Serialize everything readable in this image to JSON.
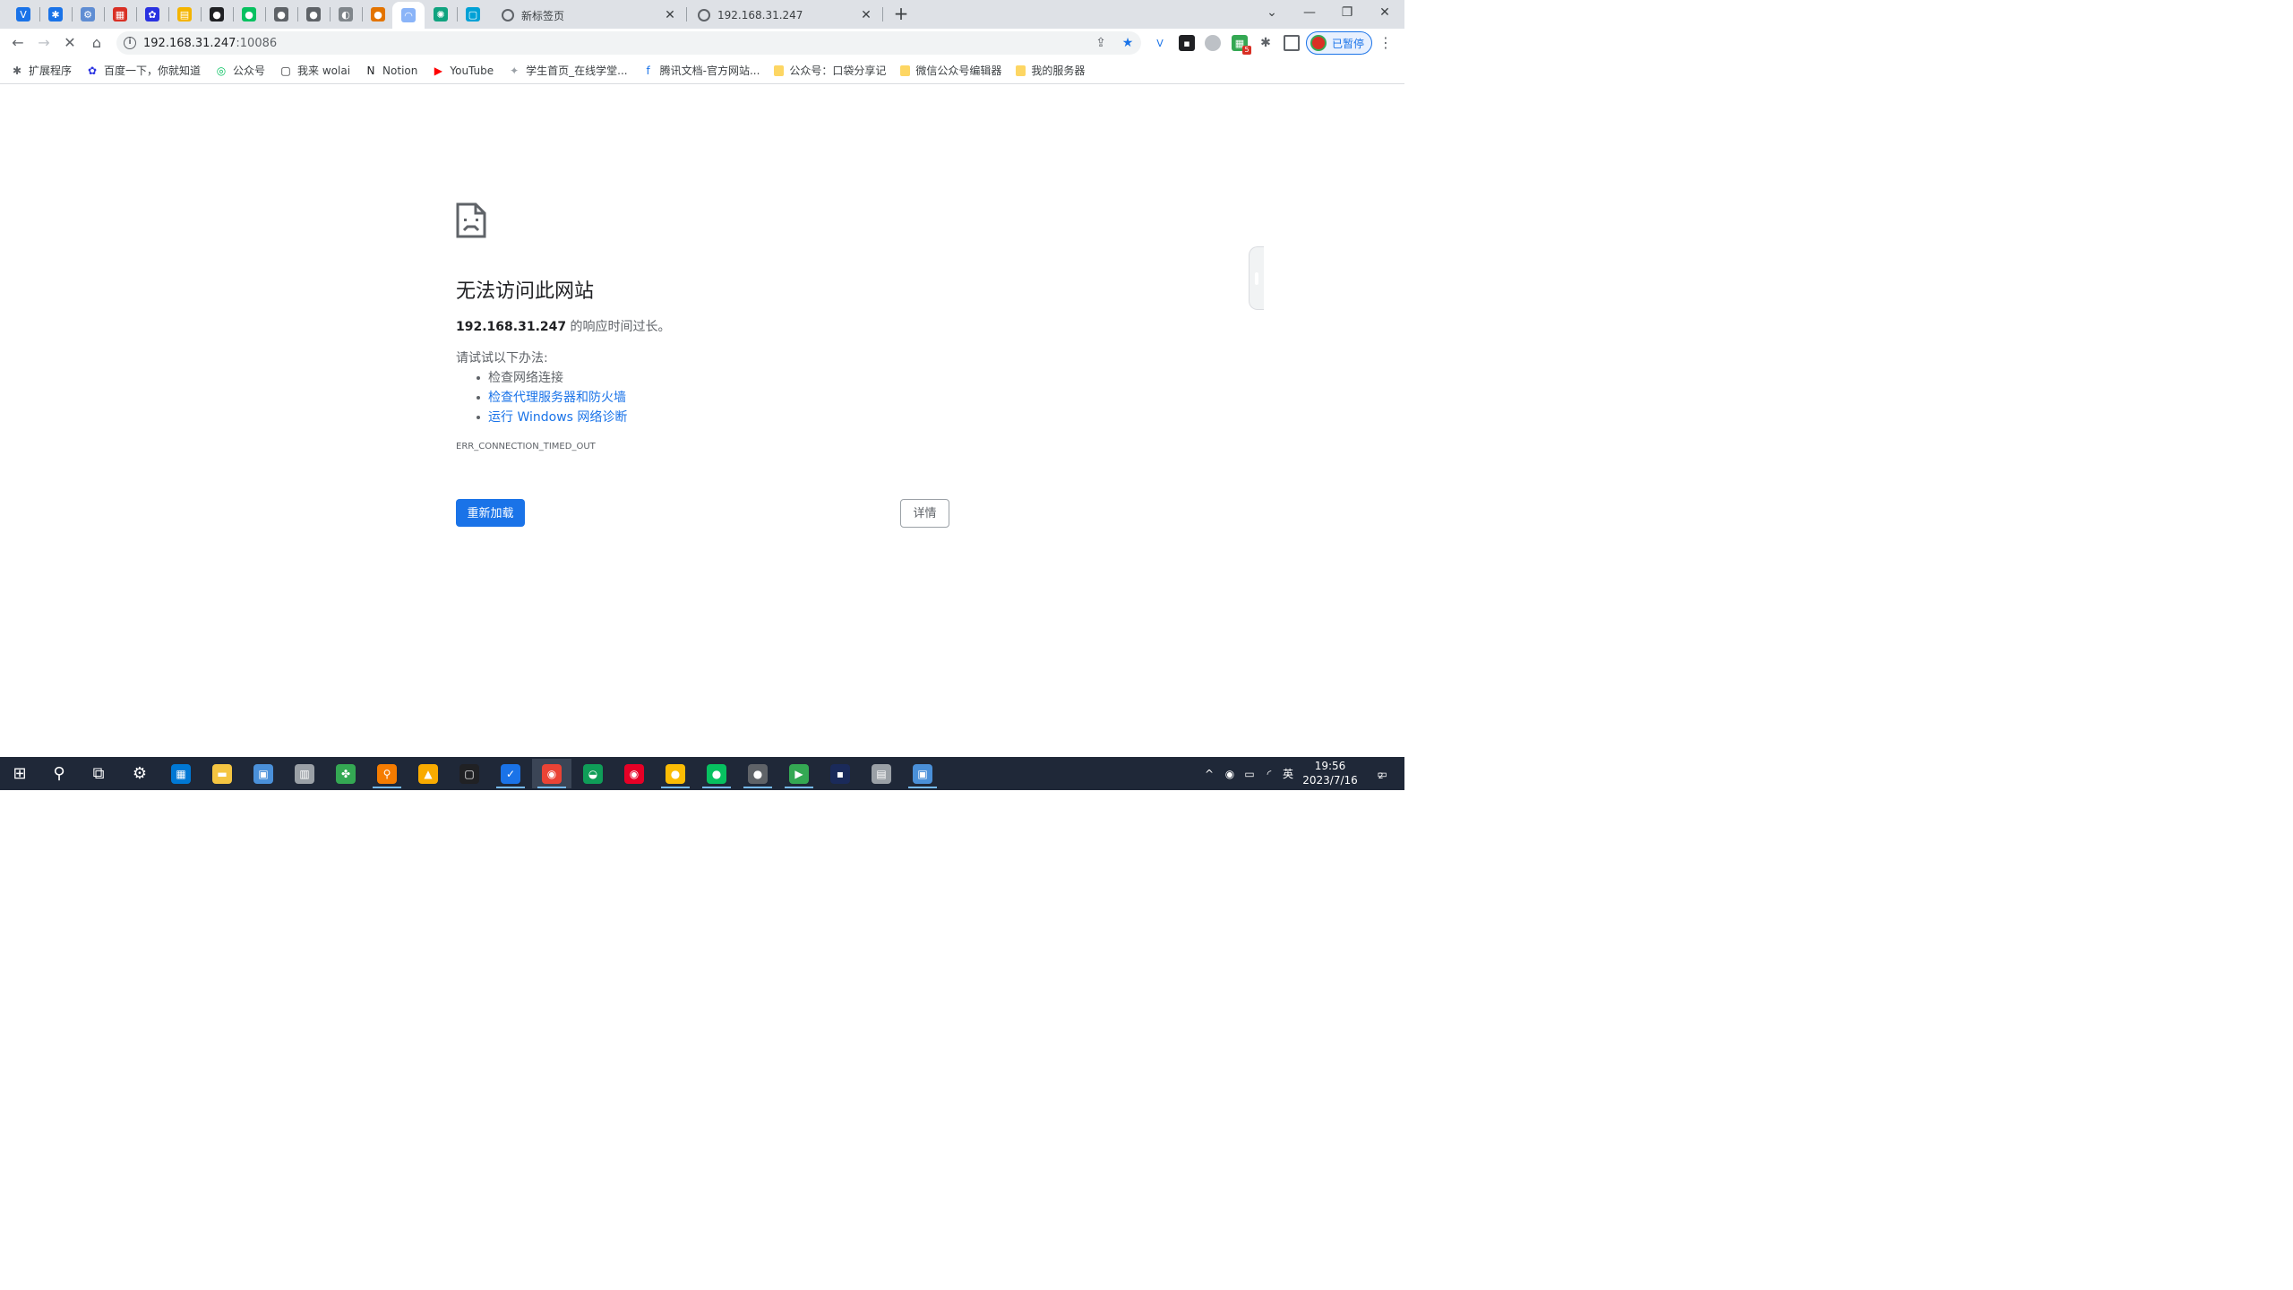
{
  "browser": {
    "pinned_tabs": [
      {
        "name": "pinned-tab-v",
        "glyph": "V",
        "color": "#1a73e8"
      },
      {
        "name": "pinned-tab-puzzle",
        "glyph": "✱",
        "color": "#1a73e8"
      },
      {
        "name": "pinned-tab-gear",
        "glyph": "⚙",
        "color": "#5f8dd3"
      },
      {
        "name": "pinned-tab-grid",
        "glyph": "▦",
        "color": "#d93025"
      },
      {
        "name": "pinned-tab-baidu",
        "glyph": "✿",
        "color": "#2932e1"
      },
      {
        "name": "pinned-tab-chart",
        "glyph": "▤",
        "color": "#f4b400"
      },
      {
        "name": "pinned-tab-qq",
        "glyph": "●",
        "color": "#202124"
      },
      {
        "name": "pinned-tab-wechat",
        "glyph": "●",
        "color": "#07c160"
      },
      {
        "name": "pinned-tab-github-1",
        "glyph": "●",
        "color": "#5f6368"
      },
      {
        "name": "pinned-tab-github-2",
        "glyph": "●",
        "color": "#5f6368"
      },
      {
        "name": "pinned-tab-globe",
        "glyph": "◐",
        "color": "#80868b"
      },
      {
        "name": "pinned-tab-fox",
        "glyph": "●",
        "color": "#e37400"
      },
      {
        "name": "pinned-tab-loading",
        "glyph": "◠",
        "color": "#8ab4f8"
      },
      {
        "name": "pinned-tab-chatgpt",
        "glyph": "✺",
        "color": "#10a37f"
      },
      {
        "name": "pinned-tab-bilibili",
        "glyph": "▢",
        "color": "#00a1d6"
      }
    ],
    "tabs": [
      {
        "title": "新标签页"
      },
      {
        "title": "192.168.31.247"
      }
    ],
    "window_controls": {
      "tabsearch": "⌄",
      "minimize": "—",
      "restore": "❐",
      "close": "✕"
    },
    "nav": {
      "back": "←",
      "forward": "→",
      "reload": "✕",
      "home": "⌂"
    },
    "url_host": "192.168.31.247",
    "url_port": ":10086",
    "profile_label": "已暂停",
    "extension_badge": "5"
  },
  "bookmarks": [
    {
      "label": "扩展程序",
      "glyph": "✱",
      "color": "#5f6368"
    },
    {
      "label": "百度一下，你就知道",
      "glyph": "✿",
      "color": "#2932e1"
    },
    {
      "label": "公众号",
      "glyph": "◎",
      "color": "#07c160"
    },
    {
      "label": "我来 wolai",
      "glyph": "▢",
      "color": "#202124"
    },
    {
      "label": "Notion",
      "glyph": "N",
      "color": "#202124"
    },
    {
      "label": "YouTube",
      "glyph": "▶",
      "color": "#ff0000"
    },
    {
      "label": "学生首页_在线学堂...",
      "glyph": "✦",
      "color": "#9aa0a6"
    },
    {
      "label": "腾讯文档-官方网站...",
      "glyph": "f",
      "color": "#1a73e8"
    },
    {
      "label": "公众号：口袋分享记",
      "glyph": "",
      "color": "#fdd663"
    },
    {
      "label": "微信公众号编辑器",
      "glyph": "",
      "color": "#fdd663"
    },
    {
      "label": "我的服务器",
      "glyph": "",
      "color": "#fdd663"
    }
  ],
  "error_page": {
    "title": "无法访问此网站",
    "host": "192.168.31.247",
    "desc_suffix": " 的响应时间过长。",
    "try_label": "请试试以下办法:",
    "suggestions": [
      {
        "text": "检查网络连接",
        "link": false
      },
      {
        "text": "检查代理服务器和防火墙",
        "link": true
      },
      {
        "text": "运行 Windows 网络诊断",
        "link": true
      }
    ],
    "error_code": "ERR_CONNECTION_TIMED_OUT",
    "reload_label": "重新加载",
    "details_label": "详情"
  },
  "taskbar": {
    "apps": [
      {
        "name": "start-button",
        "glyph": "⊞",
        "color": "#ffffff"
      },
      {
        "name": "search-button",
        "glyph": "⚲",
        "color": "#ffffff"
      },
      {
        "name": "task-view-button",
        "glyph": "⧉",
        "color": "#ffffff"
      },
      {
        "name": "settings-app",
        "glyph": "⚙",
        "color": "#ffffff"
      },
      {
        "name": "store-app",
        "glyph": "▦",
        "color": "#0078d4"
      },
      {
        "name": "explorer-app",
        "glyph": "▬",
        "color": "#f4c542"
      },
      {
        "name": "control-panel-app",
        "glyph": "▣",
        "color": "#4a90d9"
      },
      {
        "name": "bin-app",
        "glyph": "▥",
        "color": "#9aa0a6"
      },
      {
        "name": "clover-app",
        "glyph": "✤",
        "color": "#34a853"
      },
      {
        "name": "everything-app",
        "glyph": "⚲",
        "color": "#f57c00"
      },
      {
        "name": "media-app",
        "glyph": "▲",
        "color": "#f9ab00"
      },
      {
        "name": "terminal-app",
        "glyph": "▢",
        "color": "#202124"
      },
      {
        "name": "todo-app",
        "glyph": "✓",
        "color": "#1a73e8"
      },
      {
        "name": "chrome-app",
        "glyph": "◉",
        "color": "#ea4335"
      },
      {
        "name": "edge-app",
        "glyph": "◒",
        "color": "#0f9d58"
      },
      {
        "name": "netease-music-app",
        "glyph": "◉",
        "color": "#e60026"
      },
      {
        "name": "music-app",
        "glyph": "●",
        "color": "#fbbc04"
      },
      {
        "name": "wechat-app",
        "glyph": "●",
        "color": "#07c160"
      },
      {
        "name": "avatar-app",
        "glyph": "●",
        "color": "#5f6368"
      },
      {
        "name": "player-app",
        "glyph": "▶",
        "color": "#34a853"
      },
      {
        "name": "dark-app",
        "glyph": "▪",
        "color": "#1a2a5a"
      },
      {
        "name": "paint-app",
        "glyph": "▤",
        "color": "#9aa0a6"
      },
      {
        "name": "remote-desktop-app",
        "glyph": "▣",
        "color": "#4a90d9"
      }
    ],
    "tray": {
      "chevron": "^",
      "ime": "英",
      "time": "19:56",
      "date": "2023/7/16",
      "notifications": "2"
    }
  }
}
